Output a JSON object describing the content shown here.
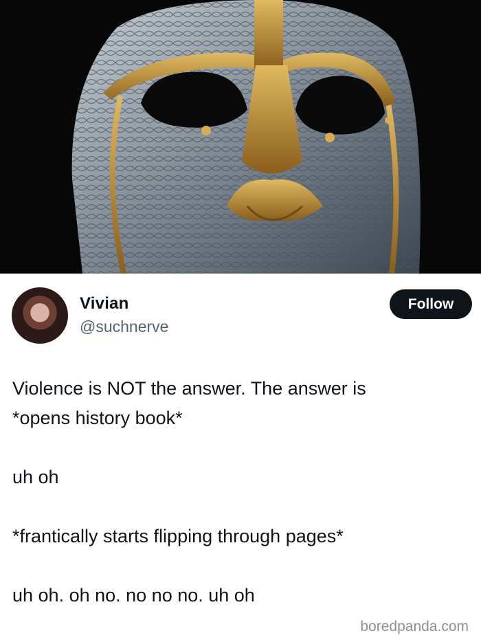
{
  "author": {
    "display_name": "Vivian",
    "handle": "@suchnerve"
  },
  "follow_button": {
    "label": "Follow"
  },
  "tweet": {
    "lines": [
      "Violence is NOT the answer. The answer is",
      "*opens history book*",
      "uh oh",
      "*frantically starts flipping through pages*",
      "uh oh. oh no. no no no. uh oh"
    ]
  },
  "watermark": {
    "text": "boredpanda.com"
  },
  "colors": {
    "text_primary": "#0f1419",
    "text_secondary": "#536471",
    "button_bg": "#0f1419",
    "hero_gold": "#c89a3a",
    "hero_silver": "#9aa3ab"
  }
}
